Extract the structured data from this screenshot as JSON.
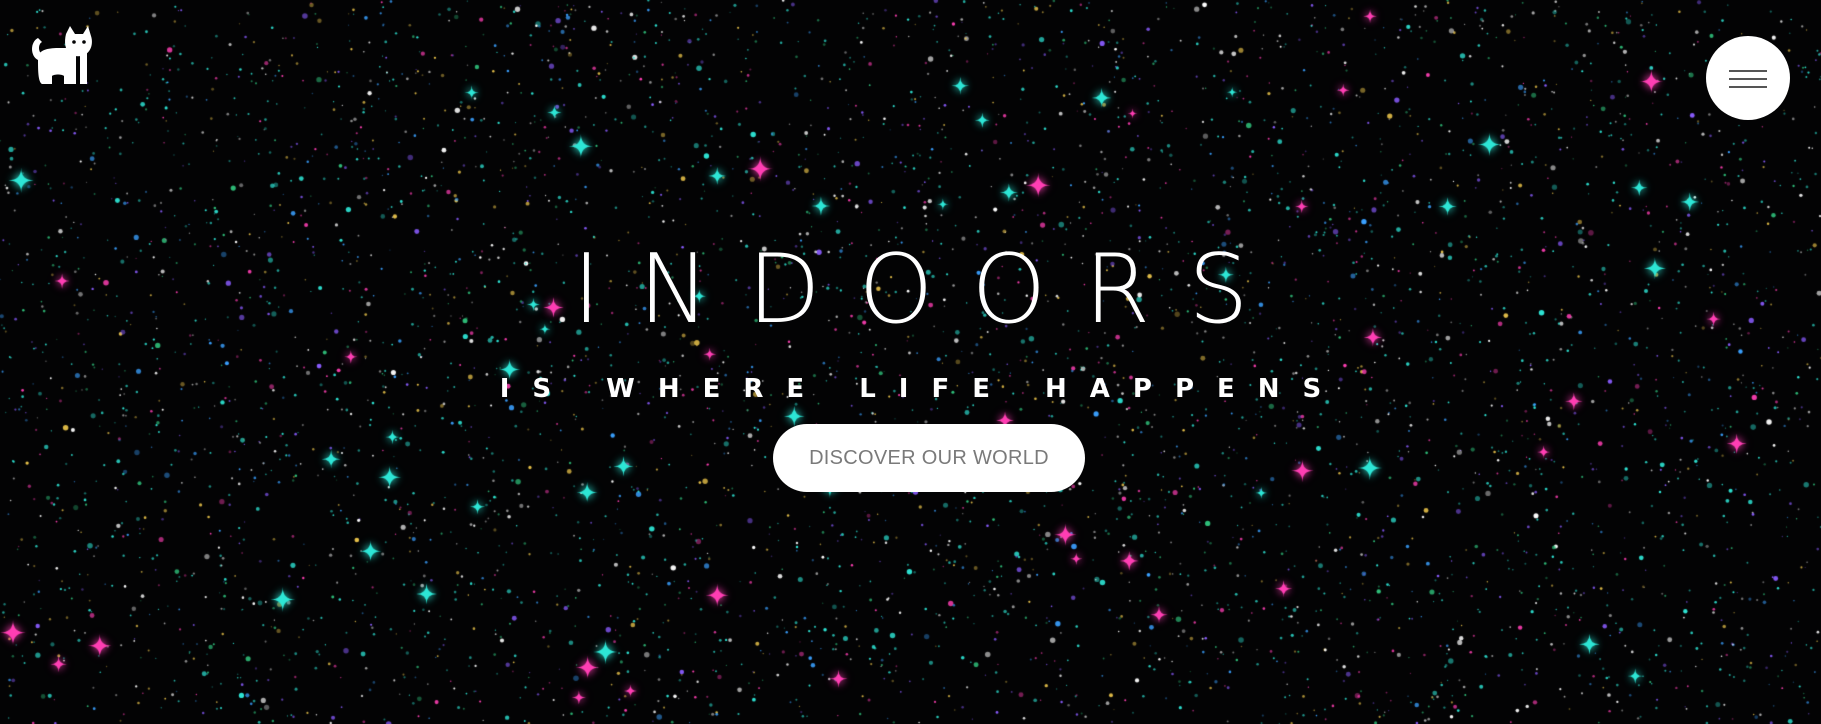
{
  "header": {
    "logo_icon": "cat-icon",
    "menu_icon": "hamburger-menu-icon"
  },
  "hero": {
    "title": "INDOORS",
    "subtitle": "IS WHERE LIFE HAPPENS",
    "cta_label": "DISCOVER OUR WORLD"
  },
  "colors": {
    "background": "#030304",
    "text": "#ffffff",
    "button_bg": "#ffffff",
    "button_text": "#7a7a7a",
    "star_cyan": "#2ee6d6",
    "star_pink": "#ff3fb4",
    "star_white": "#ffffff",
    "star_yellow": "#e8c24a",
    "star_purple": "#8a5cff"
  }
}
